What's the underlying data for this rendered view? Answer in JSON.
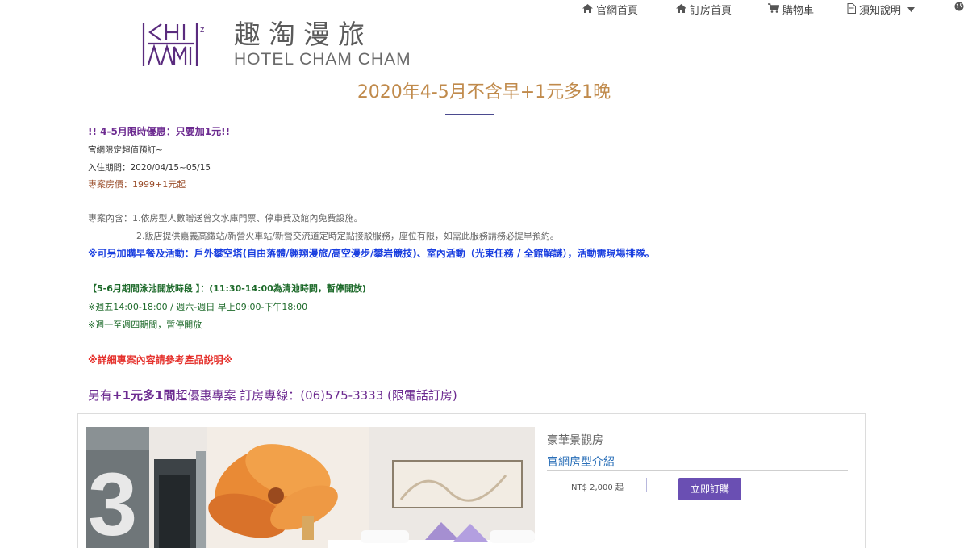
{
  "nav": {
    "home": "官網首頁",
    "booking": "訂房首頁",
    "cart": "購物車",
    "notice": "須知說明"
  },
  "logo": {
    "mark_text_top": "KHZ",
    "mark_text_bottom": "AAMI",
    "name_cn": "趣淘漫旅",
    "name_en": "HOTEL CHAM CHAM"
  },
  "page": {
    "title": "2020年4-5月不含早+1元多1晚"
  },
  "content": {
    "headline": "!! 4-5月限時優惠：只要加1元!!",
    "line_official": "官網限定超值預訂~",
    "line_period": "入住期間：2020/04/15~05/15",
    "line_price": "專案房價：1999+1元起",
    "line_includes_1": "專案內含：1.依房型人數贈送曾文水庫門票、停車費及館內免費設施。",
    "line_includes_2": "2.飯店提供嘉義高鐵站/新營火車站/新營交流道定時定點接駁服務，座位有限，如需此服務請務必提早預約。",
    "line_addon": "※可另加購早餐及活動：戶外攀空塔(自由落體/翱翔漫旅/高空漫步/攀岩競技)、室內活動（光束任務 / 全館解謎），活動需現場排隊。",
    "line_pool_title": "【5-6月期間泳池開放時段 】：(11:30-14:00為清池時間，暫停開放)",
    "line_pool_1": "※週五14:00-18:00 / 週六-週日 早上09:00-下午18:00",
    "line_pool_2": "※週一至週四期間，暫停開放",
    "line_detail": "※詳細專案內容請參考產品說明※",
    "promo_prefix": "另有",
    "promo_bold": "+1元多1間",
    "promo_suffix": "超優惠專案  訂房專線：(06)575-3333 (限電話訂房)"
  },
  "room": {
    "name": "豪華景觀房",
    "link": "官網房型介紹",
    "price": "NT$ 2,000 起",
    "buy_label": "立即訂購",
    "photo_number": "3"
  },
  "colors": {
    "title": "#c08a4b",
    "accent_purple": "#6c2a90",
    "button": "#6a4fb3",
    "link_blue": "#2a6fb8",
    "addon_blue": "#1a3fe0",
    "pool_green": "#1d6a2a",
    "detail_red": "#e5322d"
  },
  "icons": {
    "home": "home-icon",
    "booking": "home-icon",
    "cart": "cart-icon",
    "notice": "document-icon",
    "dropdown": "caret-down-icon",
    "globe": "globe-icon"
  }
}
